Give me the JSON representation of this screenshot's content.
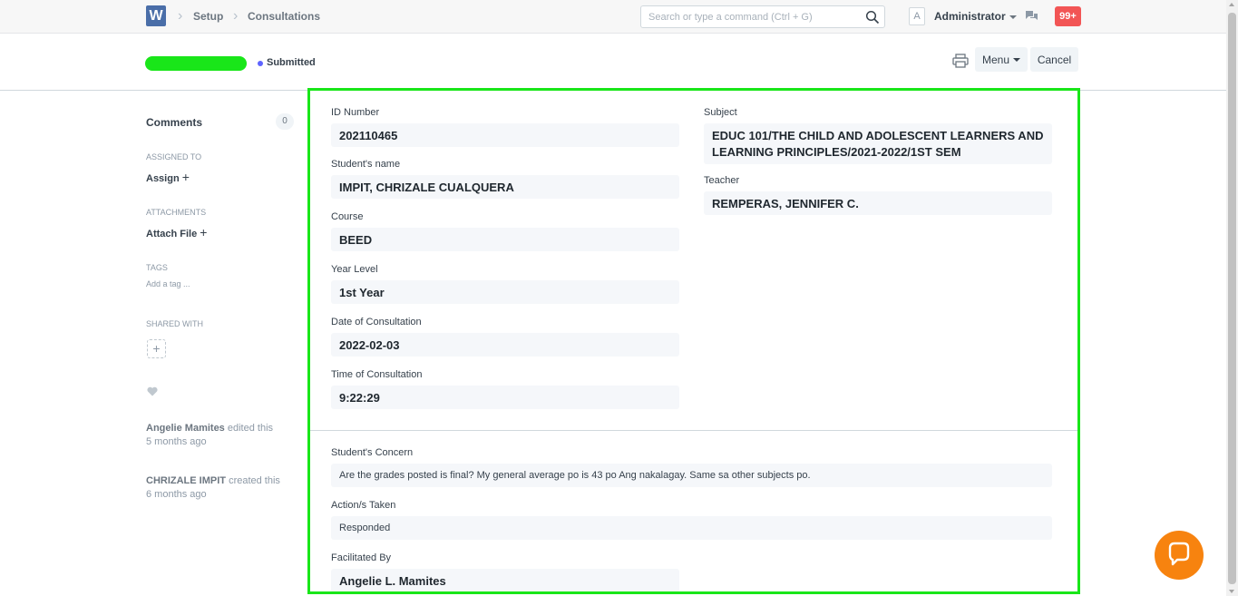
{
  "navbar": {
    "logo": "W",
    "breadcrumbs": [
      "Setup",
      "Consultations"
    ],
    "search_placeholder": "Search or type a command (Ctrl + G)",
    "avatar_letter": "A",
    "user_name": "Administrator",
    "notification_count": "99+",
    "icons": {
      "search": "search-icon",
      "chat": "chat-icon",
      "print": "printer-icon"
    }
  },
  "page": {
    "status": "Submitted",
    "status_color": "#5e64ff",
    "menu_label": "Menu",
    "cancel_label": "Cancel"
  },
  "sidebar": {
    "comments_label": "Comments",
    "comments_count": "0",
    "assigned_to_label": "ASSIGNED TO",
    "assign_action": "Assign",
    "attachments_label": "ATTACHMENTS",
    "attach_action": "Attach File",
    "tags_label": "TAGS",
    "add_tag": "Add a tag ...",
    "shared_with_label": "SHARED WITH",
    "add_share": "+",
    "activity": [
      {
        "user": "Angelie Mamites",
        "action": "edited this",
        "time": "5 months ago"
      },
      {
        "user": "CHRIZALE IMPIT",
        "action": "created this",
        "time": "6 months ago"
      }
    ]
  },
  "form": {
    "id_number": {
      "label": "ID Number",
      "value": "202110465"
    },
    "student_name": {
      "label": "Student's name",
      "value": "IMPIT, CHRIZALE CUALQUERA"
    },
    "course": {
      "label": "Course",
      "value": "BEED"
    },
    "year_level": {
      "label": "Year Level",
      "value": "1st Year"
    },
    "date_of_consultation": {
      "label": "Date of Consultation",
      "value": "2022-02-03"
    },
    "time_of_consultation": {
      "label": "Time of Consultation",
      "value": "9:22:29"
    },
    "subject": {
      "label": "Subject",
      "value_line1": "EDUC 101/THE CHILD AND ADOLESCENT LEARNERS AND",
      "value_line2": "LEARNING PRINCIPLES/2021-2022/1ST SEM"
    },
    "teacher": {
      "label": "Teacher",
      "value": "REMPERAS, JENNIFER C."
    },
    "students_concern": {
      "label": "Student's Concern",
      "value": "Are the grades posted is final? My general average po is 43 po Ang nakalagay. Same sa other subjects po."
    },
    "actions_taken": {
      "label": "Action/s Taken",
      "value": "Responded"
    },
    "facilitated_by": {
      "label": "Facilitated By",
      "value": "Angelie L. Mamites"
    }
  },
  "colors": {
    "highlight_border": "#19e619",
    "chat_bubble": "#f7830f",
    "badge": "#f25555",
    "logo": "#4a6ea8"
  }
}
